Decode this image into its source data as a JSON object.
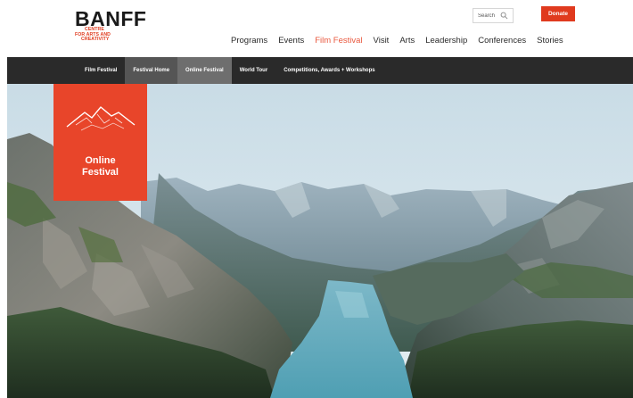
{
  "brand": {
    "wordmark": "BANFF",
    "tagline_lines": [
      "Centre",
      "for Arts and",
      "Creativity"
    ],
    "accent_color": "#e03a1e"
  },
  "header": {
    "search": {
      "placeholder": "Search",
      "icon": "search-icon"
    },
    "donate_label": "Donate",
    "nav": [
      {
        "label": "Programs",
        "active": false
      },
      {
        "label": "Events",
        "active": false
      },
      {
        "label": "Film Festival",
        "active": true
      },
      {
        "label": "Visit",
        "active": false
      },
      {
        "label": "Arts",
        "active": false
      },
      {
        "label": "Leadership",
        "active": false
      },
      {
        "label": "Conferences",
        "active": false
      },
      {
        "label": "Stories",
        "active": false
      }
    ]
  },
  "sub_nav": {
    "items": [
      {
        "label": "Film Festival"
      },
      {
        "label": "Festival Home"
      },
      {
        "label": "Online Festival"
      },
      {
        "label": "World Tour"
      },
      {
        "label": "Competitions, Awards + Workshops"
      }
    ]
  },
  "hero": {
    "badge_lines": [
      "Online",
      "Festival"
    ],
    "badge_icon": "mountain-icon",
    "badge_color": "#e8452a"
  }
}
